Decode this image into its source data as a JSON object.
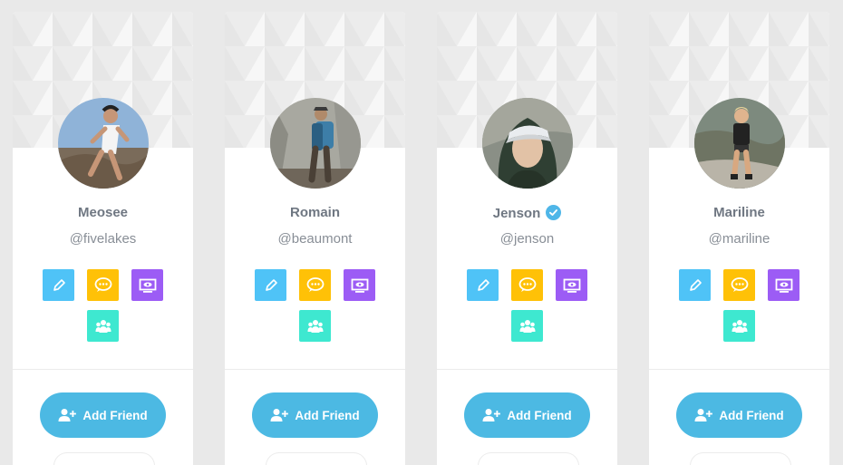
{
  "cards": [
    {
      "name": "Meosee",
      "handle": "@fivelakes",
      "verified": false,
      "add_label": "Add Friend"
    },
    {
      "name": "Romain",
      "handle": "@beaumont",
      "verified": false,
      "add_label": "Add Friend"
    },
    {
      "name": "Jenson",
      "handle": "@jenson",
      "verified": true,
      "add_label": "Add Friend"
    },
    {
      "name": "Mariline",
      "handle": "@mariline",
      "verified": false,
      "add_label": "Add Friend"
    }
  ],
  "actions": [
    {
      "icon": "pencil-icon",
      "color": "#4fc3f7"
    },
    {
      "icon": "chat-bubble-icon",
      "color": "#ffc107"
    },
    {
      "icon": "display-eye-icon",
      "color": "#9c5cf5"
    },
    {
      "icon": "group-icon",
      "color": "#3ee8d0"
    }
  ],
  "colors": {
    "page_bg": "#e9e9e9",
    "card_bg": "#ffffff",
    "accent": "#4cb9e3",
    "verified_badge": "#4fb6e8"
  }
}
